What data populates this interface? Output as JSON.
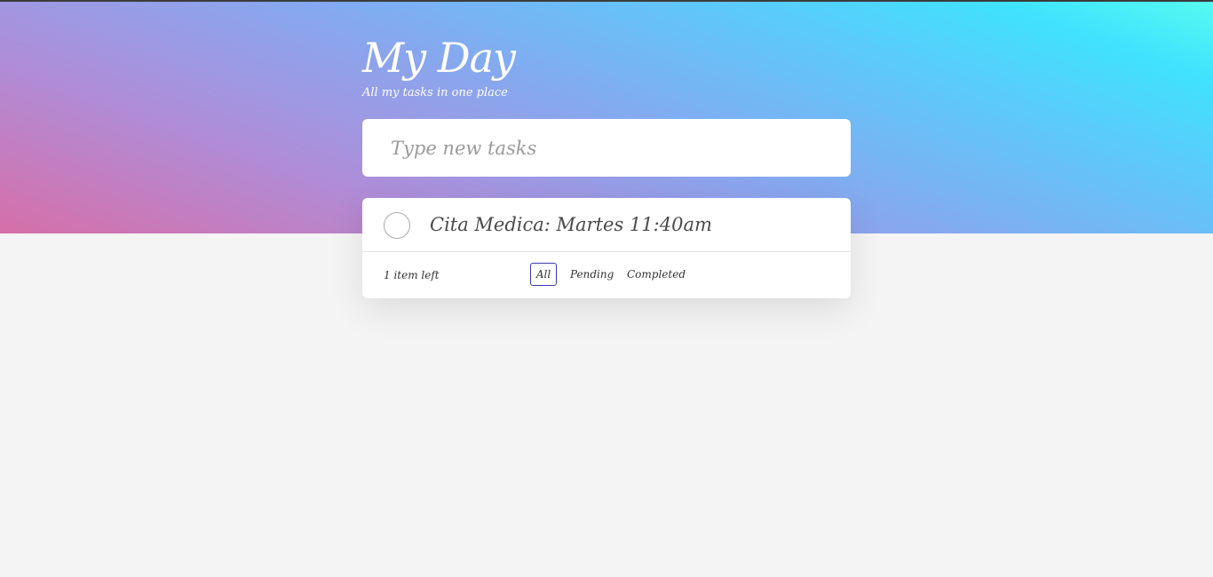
{
  "header": {
    "title": "My Day",
    "subtitle": "All my tasks in one place"
  },
  "new_task": {
    "placeholder": "Type new tasks",
    "value": ""
  },
  "tasks": [
    {
      "text": "Cita Medica: Martes 11:40am",
      "completed": false
    }
  ],
  "footer": {
    "items_left": "1 item left",
    "filters": [
      {
        "label": "All",
        "active": true
      },
      {
        "label": "Pending",
        "active": false
      },
      {
        "label": "Completed",
        "active": false
      }
    ]
  },
  "colors": {
    "gradient": [
      "#d66fa8",
      "#ac8fdb",
      "#86a8ef",
      "#5ec8fb",
      "#40e2fd",
      "#55fbf0"
    ],
    "page_background": "#f4f4f4",
    "active_filter_border": "#3a3aa8"
  }
}
